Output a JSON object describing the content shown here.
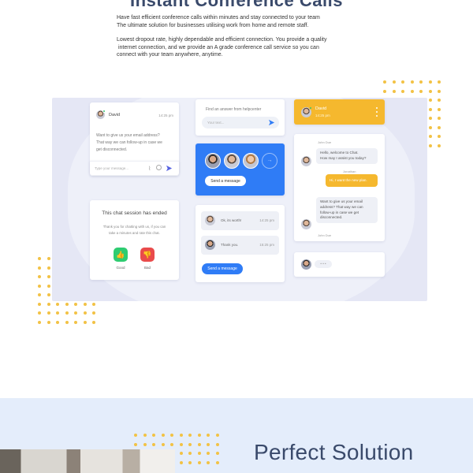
{
  "hero": {
    "title": "Instant Conference Calls",
    "paragraph1_line1": "Have fast efficient conference calls within minutes and stay connected to your team",
    "paragraph1_line2": "The ultimate solution for businesses utilising work from home and remote staff.",
    "paragraph2_line1": "Lowest dropout rate, highly dependable and efficient connection. You provide a quality",
    "paragraph2_line2": "internet connection, and we provide an A grade conference call service so you can",
    "paragraph2_line3": "connect with your team anywhere, anytime."
  },
  "chat_card": {
    "name": "David",
    "time": "14:25 pm",
    "message_line1": "Want to give us your email address?",
    "message_line2": "That way we can follow-up in case we",
    "message_line3": "get disconnected.",
    "input_placeholder": "Type your message..."
  },
  "ended_card": {
    "title": "This chat session has ended",
    "text_line1": "Thank you for chatting with us, if you can",
    "text_line2": "take a minutes and rate this chat.",
    "good_label": "Good",
    "bad_label": "Bad"
  },
  "help_card": {
    "title": "Find an answer from helpcenter",
    "placeholder": "Your text..."
  },
  "team_card": {
    "button_label": "Send a message"
  },
  "thread_card": {
    "items": [
      {
        "text": "Ok, its worth!",
        "time": "14:25 pm"
      },
      {
        "text": "Thank you.",
        "time": "15:25 pm"
      }
    ],
    "button_label": "Send a message"
  },
  "header_card": {
    "name": "David",
    "time": "14:25 pm"
  },
  "conversation": {
    "agent1": "John Due",
    "greeting_line1": "Hello, welcome to Chat.",
    "greeting_line2": "How may I assist you today?",
    "user_name": "Jonathan",
    "user_message": "Hi, I want the new plan.",
    "email_line1": "Want to give us your email",
    "email_line2": "address? That way we can",
    "email_line3": "follow-up in case we get",
    "email_line4": "disconnected.",
    "agent2": "John Due"
  },
  "typing_card": {
    "dots": "• • •"
  },
  "section2": {
    "title": "Perfect Solution"
  },
  "colors": {
    "accent_blue": "#2f7cf6",
    "accent_yellow": "#f5b82e",
    "good_green": "#2ecc71",
    "bad_red": "#e94b4b",
    "title_navy": "#3a4a6b"
  }
}
